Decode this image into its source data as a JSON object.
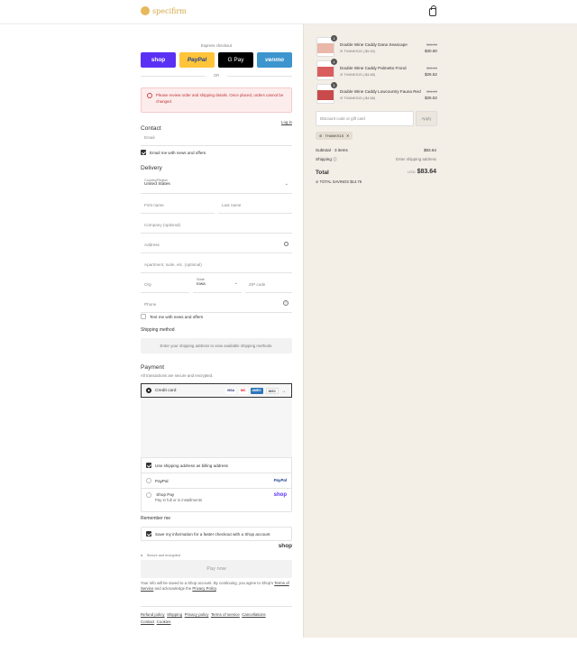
{
  "header": {
    "logo_text": "specifirm",
    "cart_icon": "bag-icon"
  },
  "express": {
    "title": "Express checkout",
    "or": "OR",
    "buttons": [
      {
        "label": "shop",
        "bg": "#5a31f4",
        "fg": "#ffffff"
      },
      {
        "label": "PayPal",
        "bg": "#ffc439",
        "fg": "#1b3d8f"
      },
      {
        "label": "G Pay",
        "bg": "#000000",
        "fg": "#ffffff"
      },
      {
        "label": "venmo",
        "bg": "#3d95ce",
        "fg": "#ffffff"
      }
    ]
  },
  "alert": {
    "text": "Please review order and shipping details. Once placed, orders cannot be changed."
  },
  "contact": {
    "title": "Contact",
    "login": "Log in",
    "email_placeholder": "Email",
    "news_label": "Email me with news and offers"
  },
  "delivery": {
    "title": "Delivery",
    "country_label": "Country/Region",
    "country_value": "United States",
    "first_name": "First name",
    "last_name": "Last name",
    "company": "Company (optional)",
    "address": "Address",
    "apartment": "Apartment, suite, etc. (optional)",
    "city": "City",
    "state_label": "State",
    "state_value": "Iowa",
    "zip": "ZIP code",
    "phone": "Phone",
    "sms_label": "Text me with news and offers"
  },
  "shipping": {
    "title": "Shipping method",
    "placeholder": "Enter your shipping address to view available shipping methods."
  },
  "payment": {
    "title": "Payment",
    "subtitle": "All transactions are secure and encrypted.",
    "credit_card": "Credit card",
    "cards": [
      "VISA",
      "MC",
      "AMEX",
      "DISC"
    ],
    "billing_label": "Use shipping address as billing address",
    "paypal": "PayPal",
    "paypal_logo": "PayPal",
    "shoppay": "Shop Pay",
    "shoppay_sub": "Pay in full or in installments",
    "shoppay_logo": "shop"
  },
  "remember": {
    "title": "Remember me",
    "save_label": "Save my information for a faster checkout with a Shop account",
    "secure": "Secure and encrypted",
    "shop_logo": "shop"
  },
  "pay_now": "Pay now",
  "legal": {
    "prefix": "Your info will be saved to a Shop account. By continuing, you agree to Shop's",
    "terms": "Terms of Service",
    "mid": "and acknowledge the",
    "privacy": "Privacy Policy",
    "suffix": "."
  },
  "footer_links": [
    "Refund policy",
    "Shipping",
    "Privacy policy",
    "Terms of service",
    "Cancellations",
    "Contact",
    "Cookies"
  ],
  "summary": {
    "items": [
      {
        "qty": "1",
        "name": "Double Wine Caddy Dana Seascape",
        "discount": "THANKS15 (-$5.40)",
        "old_price": "$36.00",
        "price": "$30.60",
        "img_color": "#e9b8a8"
      },
      {
        "qty": "1",
        "name": "Double Wine Caddy Palmetto Frond",
        "discount": "THANKS15 (-$4.68)",
        "old_price": "$31.20",
        "price": "$26.52",
        "img_color": "#d95d5d"
      },
      {
        "qty": "1",
        "name": "Double Wine Caddy Lowcountry Fauna Red",
        "discount": "THANKS15 (-$4.68)",
        "old_price": "$31.20",
        "price": "$26.52",
        "img_color": "#c94a4a"
      }
    ],
    "discount_placeholder": "Discount code or gift card",
    "apply": "Apply",
    "code_tag": "THANKS15",
    "subtotal_label": "Subtotal · 3 items",
    "subtotal": "$83.64",
    "shipping_label": "Shipping",
    "shipping_value": "Enter shipping address",
    "total_label": "Total",
    "currency": "USD",
    "total": "$83.64",
    "savings_label": "TOTAL SAVINGS",
    "savings": "$14.76"
  }
}
